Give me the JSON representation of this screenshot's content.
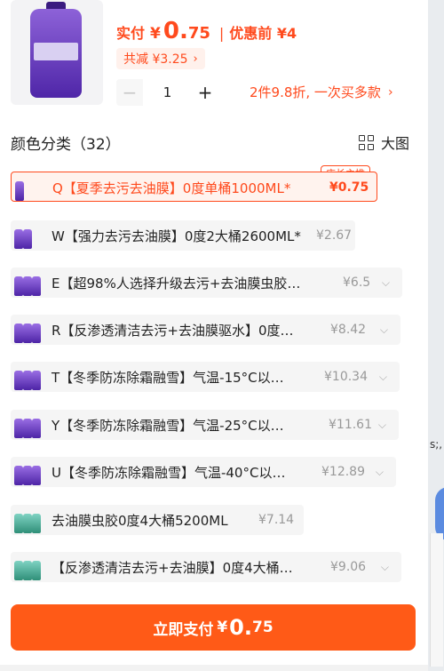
{
  "header": {
    "paid_label": "实付",
    "currency": "¥",
    "price_int": "0.",
    "price_dec": "75",
    "separator": "|",
    "before_label": "优惠前 ¥4",
    "savings": "共减 ¥3.25",
    "promo": "2件9.8折, 一次买多款",
    "quantity": "1",
    "minus": "−",
    "plus": "+"
  },
  "section": {
    "title": "颜色分类（32）",
    "big_view": "大图"
  },
  "options": [
    {
      "text": "Q【夏季去污去油膜】0度单桶1000ML*",
      "price": "¥0.75",
      "selected": true,
      "badge": "店长主推",
      "bottle_color": "#6a3fc4"
    },
    {
      "text": "W【强力去污去油膜】0度2大桶2600ML*",
      "price": "¥2.67",
      "selected": false,
      "bottle_color": "#6a3fc4"
    },
    {
      "text": "E【超98%人选择升级去污+去油膜虫胶…",
      "price": "¥6.5",
      "selected": false,
      "bottle_color": "#6a3fc4"
    },
    {
      "text": "R【反渗透清洁去污+去油膜驱水】0度…",
      "price": "¥8.42",
      "selected": false,
      "bottle_color": "#6a3fc4"
    },
    {
      "text": "T【冬季防冻除霜融雪】气温-15°C以…",
      "price": "¥10.34",
      "selected": false,
      "bottle_color": "#6a3fc4"
    },
    {
      "text": "Y【冬季防冻除霜融雪】气温-25°C以…",
      "price": "¥11.61",
      "selected": false,
      "bottle_color": "#6a3fc4"
    },
    {
      "text": "U【冬季防冻除霜融雪】气温-40°C以…",
      "price": "¥12.89",
      "selected": false,
      "bottle_color": "#6a3fc4"
    },
    {
      "text": "去油膜虫胶0度4大桶5200ML",
      "price": "¥7.14",
      "selected": false,
      "bottle_color": "#3aa287"
    },
    {
      "text": "【反渗透清洁去污+去油膜】0度4大桶…",
      "price": "¥9.06",
      "selected": false,
      "bottle_color": "#3aa287"
    }
  ],
  "pay": {
    "label": "立即支付",
    "currency": "¥",
    "price_int": "0.",
    "price_dec": "75"
  },
  "side_fragment": "s;,",
  "icons": {
    "chevron_right": "›",
    "chevron_down": "⌵",
    "grid": "grid-icon"
  },
  "colors": {
    "accent": "#ff4a1d",
    "pay_button": "#ff5a17"
  }
}
